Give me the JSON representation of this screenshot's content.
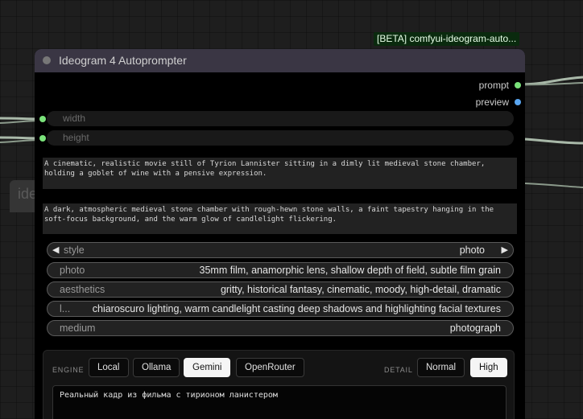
{
  "badge": "[BETA] comfyui-ideogram-auto...",
  "ghost_node": {
    "title": "ide"
  },
  "node": {
    "title": "Ideogram 4 Autoprompter"
  },
  "outputs": [
    {
      "label": "prompt",
      "color": "#7ae27a"
    },
    {
      "label": "preview",
      "color": "#5aa6f0"
    }
  ],
  "inputs": [
    {
      "label": "width",
      "color": "#7ae27a"
    },
    {
      "label": "height",
      "color": "#7ae27a"
    }
  ],
  "text_1": "A cinematic, realistic movie still of Tyrion Lannister sitting in a dimly lit medieval stone chamber, holding a goblet of wine with a pensive expression.",
  "text_2": "A dark, atmospheric medieval stone chamber with rough-hewn stone walls, a faint tapestry hanging in the soft-focus background, and the warm glow of candlelight flickering.",
  "style_combo": {
    "label": "style",
    "value": "photo",
    "left_arrow": "◀",
    "right_arrow": "▶"
  },
  "combos": [
    {
      "label": "photo",
      "value": "35mm film, anamorphic lens, shallow depth of field, subtle film grain"
    },
    {
      "label": "aesthetics",
      "value": "gritty, historical fantasy, cinematic, moody, high-detail, dramatic"
    },
    {
      "label": "l...",
      "value": "chiaroscuro lighting, warm candlelight casting deep shadows and highlighting facial textures"
    },
    {
      "label": "medium",
      "value": "photograph"
    }
  ],
  "panel": {
    "engine_label": "ENGINE",
    "engines": [
      "Local",
      "Ollama",
      "Gemini",
      "OpenRouter"
    ],
    "engine_selected": "Gemini",
    "detail_label": "DETAIL",
    "details": [
      "Normal",
      "High"
    ],
    "detail_selected": "High",
    "output_text": "Реальный кадр из фильма с тирионом ланистером"
  },
  "colors": {
    "node_header": "#3a3644",
    "link_green": "#7ae27a",
    "link_blue": "#5aa6f0",
    "wire": "#a9b9a9"
  }
}
